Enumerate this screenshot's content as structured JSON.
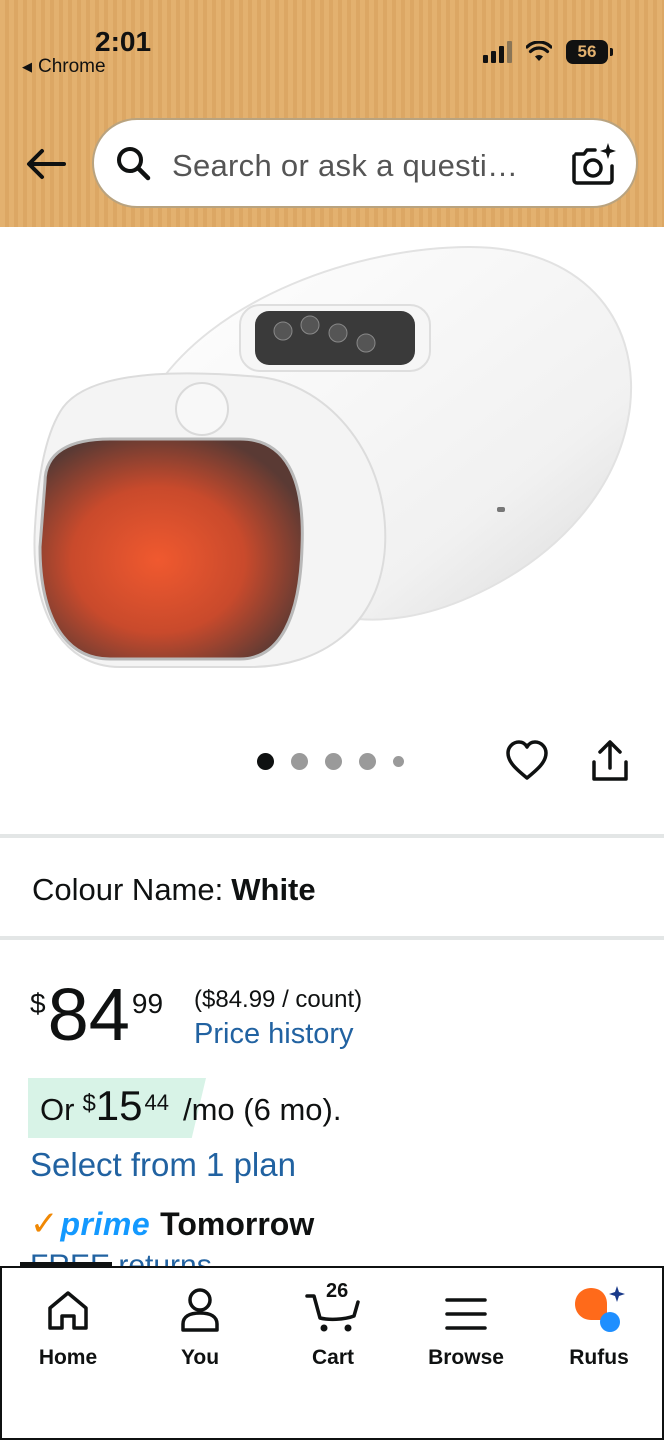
{
  "status_bar": {
    "time": "2:01",
    "back_app": "Chrome",
    "battery": "56"
  },
  "search": {
    "placeholder": "Search or ask a questi…"
  },
  "gallery": {
    "image_count": 5,
    "active_index": 0
  },
  "product": {
    "colour_label": "Colour Name:",
    "colour_value": "White"
  },
  "price": {
    "currency": "$",
    "whole": "84",
    "fraction": "99",
    "unit_price": "($84.99 / count)",
    "price_history": "Price history"
  },
  "installment": {
    "prefix": "Or",
    "currency": "$",
    "whole": "15",
    "fraction": "44",
    "term": "/mo (6 mo).",
    "select_plan": "Select from 1 plan"
  },
  "delivery": {
    "prime_check": "✓",
    "prime_label": "prime",
    "day": "Tomorrow",
    "returns": "FREE returns"
  },
  "nav": {
    "home": "Home",
    "you": "You",
    "cart": "Cart",
    "cart_count": "26",
    "browse": "Browse",
    "rufus": "Rufus"
  },
  "colors": {
    "header_bg": "#e3b16f",
    "link": "#2162a1",
    "prime_blue": "#1399ff",
    "prime_orange": "#f08804",
    "installment_bg": "#d8f3e7"
  }
}
